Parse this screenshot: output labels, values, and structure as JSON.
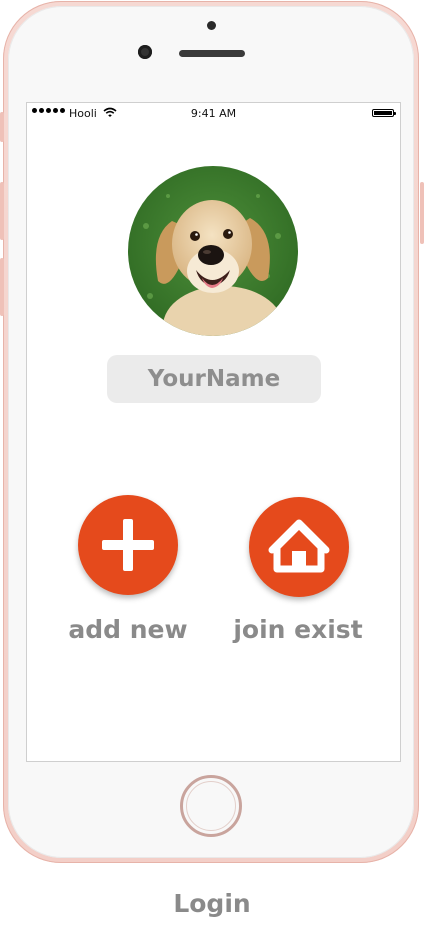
{
  "status_bar": {
    "carrier": "Hooli",
    "time": "9:41 AM"
  },
  "profile": {
    "avatar_icon": "puppy-photo",
    "name_placeholder": "YourName"
  },
  "actions": {
    "add_new": {
      "label": "add new",
      "icon": "plus-icon"
    },
    "join_exist": {
      "label": "join exist",
      "icon": "home-icon"
    }
  },
  "caption": "Login",
  "colors": {
    "accent": "#e54a1c",
    "label": "#8a8a8a",
    "field_bg": "#ebebeb",
    "phone_frame": "#f3cfc8"
  }
}
